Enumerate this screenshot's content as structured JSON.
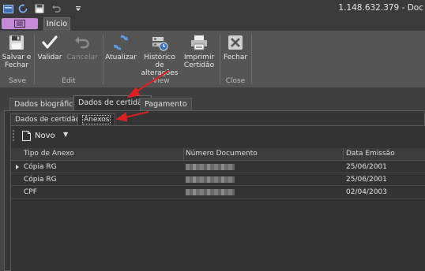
{
  "window": {
    "title": "1.148.632.379 - Doc"
  },
  "ribbon": {
    "tab_inicio": "Início",
    "buttons": {
      "salvar_fechar": "Salvar e Fechar",
      "validar": "Validar",
      "cancelar": "Cancelar",
      "atualizar": "Atualizar",
      "historico": "Histórico de alterações",
      "imprimir": "Imprimir Certidão",
      "fechar": "Fechar"
    },
    "groups": {
      "save": "Save",
      "edit": "Edit",
      "view": "View",
      "close": "Close"
    }
  },
  "tabs": [
    "Dados biográficos",
    "Dados de certidão",
    "Pagamento"
  ],
  "subtabs": [
    "Dados de certidão",
    "Anexos"
  ],
  "toolbar": {
    "novo": "Novo"
  },
  "grid": {
    "columns": [
      "Tipo de Anexo",
      "Número Documento",
      "Data Emissão"
    ],
    "rows": [
      {
        "tipo": "Cópia RG",
        "data": "25/06/2001"
      },
      {
        "tipo": "Cópia RG",
        "data": "25/06/2001"
      },
      {
        "tipo": "CPF",
        "data": "02/04/2003"
      }
    ]
  },
  "colors": {
    "annotation_arrow": "#e02020",
    "app_menu": "#c58ad6"
  }
}
